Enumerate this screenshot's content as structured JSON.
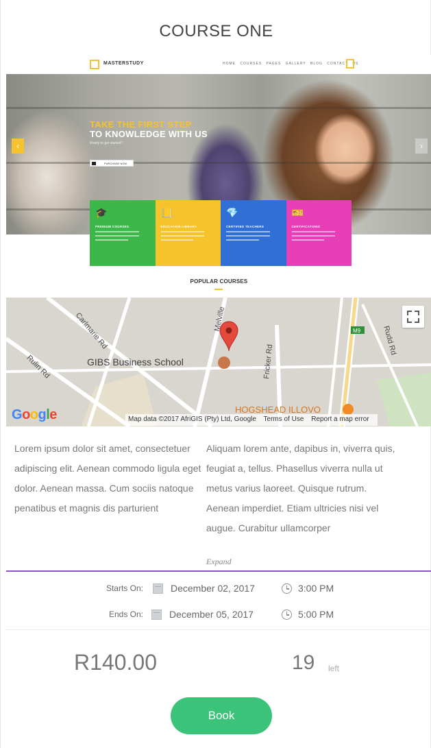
{
  "course": {
    "title": "COURSE ONE"
  },
  "hero": {
    "logo_text": "MASTERSTUDY",
    "menu": "HOME  COURSES  PAGES  GALLERY  BLOG  CONTACT US",
    "headline_1": "TAKE THE FIRST STEP",
    "headline_2": "TO KNOWLEDGE WITH US",
    "subline": "Ready to get started?",
    "button_text": "PURCHASE NOW",
    "tiles": [
      {
        "icon": "graduation-cap-icon",
        "glyph": "🎓",
        "title": "PREMIUM COURSES",
        "color": "#3cb84a"
      },
      {
        "icon": "book-icon",
        "glyph": "📒",
        "title": "EDUCATION LIBRARY",
        "color": "#f5c32c"
      },
      {
        "icon": "diamond-icon",
        "glyph": "💎",
        "title": "CERTIFIED TEACHERS",
        "color": "#2f6fd6"
      },
      {
        "icon": "certificate-icon",
        "glyph": "🎫",
        "title": "CERTIFICATIONS",
        "color": "#e83fb8"
      }
    ],
    "popular": "POPULAR COURSES"
  },
  "map": {
    "place": "GIBS Business School",
    "streets": [
      "Carlmarie Rd",
      "Rudd Rd",
      "Rulin Rd",
      "Fricker Rd",
      "Melville"
    ],
    "poi": "HOGSHEAD ILLOVO",
    "route_badge": "M9",
    "google": "Google",
    "attribution": "Map data ©2017 AfriGIS (Pty) Ltd, Google",
    "terms": "Terms of Use",
    "report": "Report a map error"
  },
  "description": {
    "col1": "Lorem ipsum dolor sit amet, consectetuer adipiscing elit. Aenean commodo ligula eget dolor. Aenean massa. Cum sociis natoque penatibus et magnis dis parturient",
    "col2": "Aliquam lorem ante, dapibus in, viverra quis, feugiat a, tellus. Phasellus viverra nulla ut metus varius laoreet. Quisque rutrum. Aenean imperdiet. Etiam ultricies nisi vel augue. Curabitur ullamcorper",
    "expand": "Expand"
  },
  "schedule": {
    "starts_label": "Starts On:",
    "starts_date": "December 02, 2017",
    "starts_time": "3:00 PM",
    "ends_label": "Ends On:",
    "ends_date": "December 05, 2017",
    "ends_time": "5:00 PM"
  },
  "booking": {
    "price": "R140.00",
    "spots": "19",
    "spots_suffix": "left",
    "book_label": "Book"
  },
  "colors": {
    "accent_purple": "#8a54c4",
    "book_green": "#3cc37a",
    "brand_yellow": "#f5c32c"
  }
}
